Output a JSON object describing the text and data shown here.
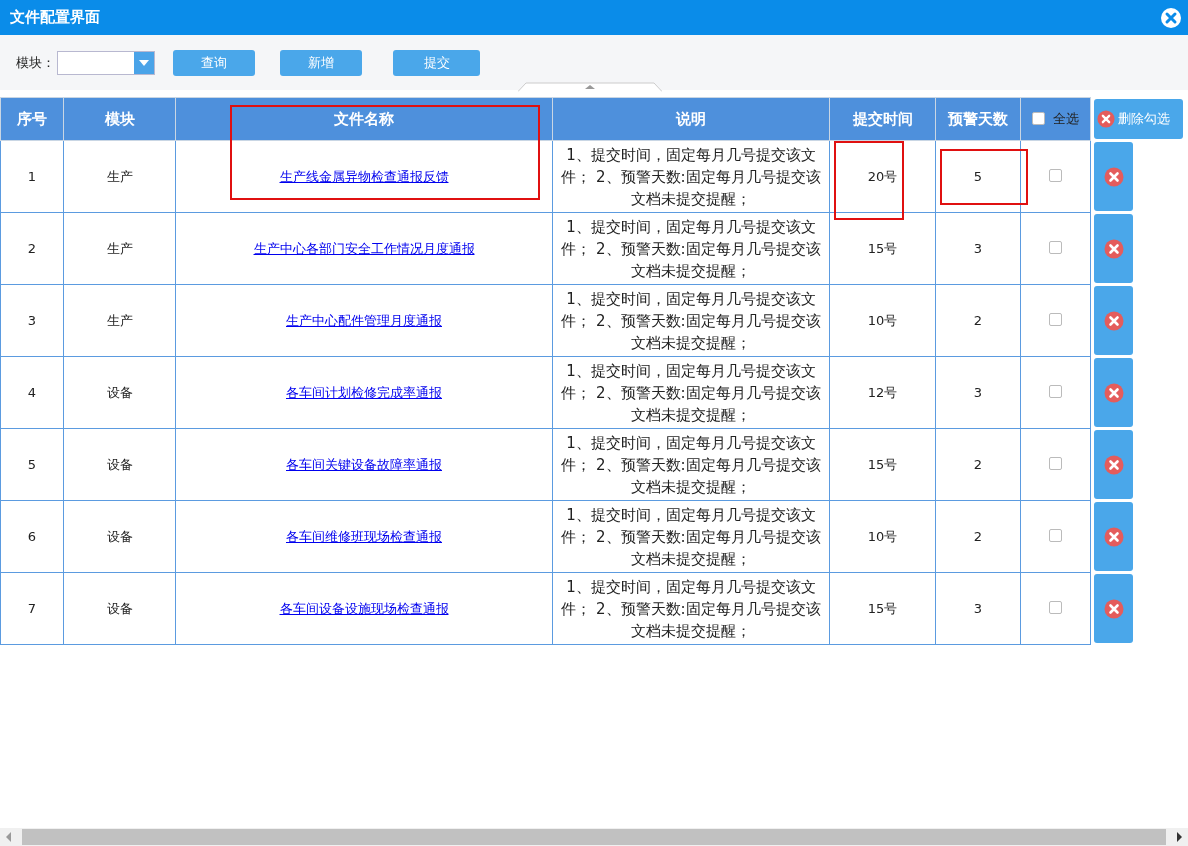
{
  "window": {
    "title": "文件配置界面"
  },
  "toolbar": {
    "module_label": "模块：",
    "buttons": [
      "查询",
      "新增",
      "提交"
    ]
  },
  "table": {
    "columns": [
      "序号",
      "模块",
      "文件名称",
      "说明",
      "提交时间",
      "预警天数"
    ],
    "select_all": {
      "label": "全选",
      "checked": false
    },
    "delete_button": "删除勾选",
    "rows": [
      {
        "no": "1",
        "module": "生产",
        "name": "生产线金属异物检查通报反馈",
        "note": "1、提交时间，固定每月几号提交该文件； 2、预警天数:固定每月几号提交该文档未提交提醒；",
        "time": "20号",
        "days": "5",
        "checked": false
      },
      {
        "no": "2",
        "module": "生产",
        "name": "生产中心各部门安全工作情况月度通报",
        "note": "1、提交时间，固定每月几号提交该文件； 2、预警天数:固定每月几号提交该文档未提交提醒；",
        "time": "15号",
        "days": "3",
        "checked": false
      },
      {
        "no": "3",
        "module": "生产",
        "name": "生产中心配件管理月度通报",
        "note": "1、提交时间，固定每月几号提交该文件； 2、预警天数:固定每月几号提交该文档未提交提醒；",
        "time": "10号",
        "days": "2",
        "checked": false
      },
      {
        "no": "4",
        "module": "设备",
        "name": "各车间计划检修完成率通报",
        "note": "1、提交时间，固定每月几号提交该文件； 2、预警天数:固定每月几号提交该文档未提交提醒；",
        "time": "12号",
        "days": "3",
        "checked": false
      },
      {
        "no": "5",
        "module": "设备",
        "name": "各车间关键设备故障率通报",
        "note": "1、提交时间，固定每月几号提交该文件； 2、预警天数:固定每月几号提交该文档未提交提醒；",
        "time": "15号",
        "days": "2",
        "checked": false
      },
      {
        "no": "6",
        "module": "设备",
        "name": "各车间维修班现场检查通报",
        "note": "1、提交时间，固定每月几号提交该文件； 2、预警天数:固定每月几号提交该文档未提交提醒；",
        "time": "10号",
        "days": "2",
        "checked": false
      },
      {
        "no": "7",
        "module": "设备",
        "name": "各车间设备设施现场检查通报",
        "note": "1、提交时间，固定每月几号提交该文件； 2、预警天数:固定每月几号提交该文档未提交提醒；",
        "time": "15号",
        "days": "3",
        "checked": false
      }
    ]
  }
}
